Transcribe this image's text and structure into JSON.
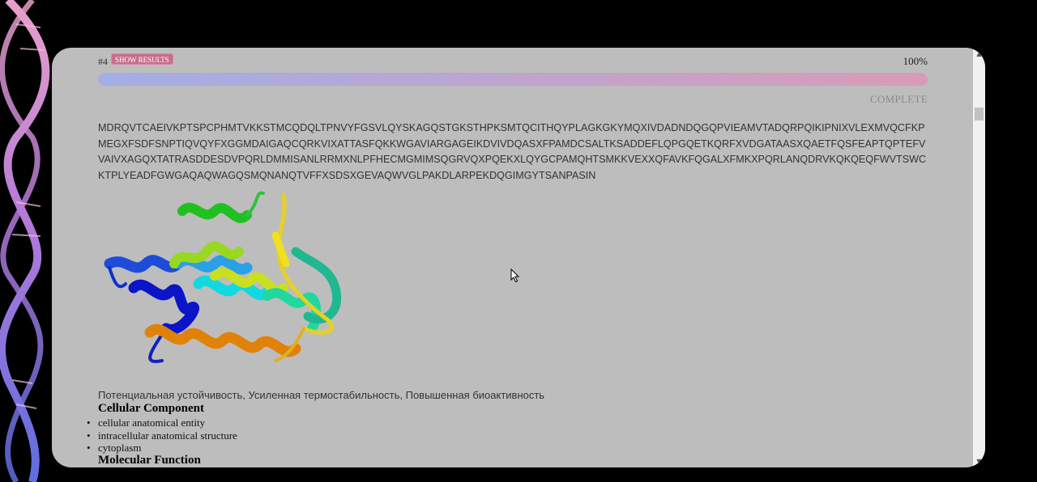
{
  "job": {
    "id_label": "#4",
    "show_results_label": "SHOW RESULTS",
    "progress_percent": 100,
    "progress_text": "100%",
    "status": "COMPLETE"
  },
  "sequence": "MDRQVTCAEIVKPTSPCPHMTVKKSTMCQDQLTPNVYFGSVLQYSKAGQSTGKSTHPKSMTQCITHQYPLAGKGKYMQXIVDADNDQGQPVIEAMVTADQRPQIKIPNIXVLEXMVQCFKPMEGXFSDFSNPTIQVQYFXGGMDAIGAQCQRKVIXATTASFQKKWGAVIARGAGEIKDVIVDQASXFPAMDCSALTKSADDEFLQPGQETKQRFXVDGATAASXQAETFQSFEAPTQPTEFVVAIVXAGQXTATRASDDESDVPQRLDMMISANLRRMXNLPFHECMGMIMSQGRVQXPQEKXLQYGCPAMQHTSMKKVEXXQFAVKFQGALXFMKXPQRLANQDRVKQKQEQFWVTSWCKTPLYEADFGWGAQAQWAGQSMQNANQTVFFXSDSXGEVAQWVGLPAKDLARPEKDQGIMGYTSANPASIN",
  "properties": "Потенциальная устойчивость, Усиленная термостабильность, Повышенная биоактивность",
  "go": {
    "cellular_component_title": "Cellular Component",
    "cellular_component": [
      "cellular anatomical entity",
      "intracellular anatomical structure",
      "cytoplasm"
    ],
    "molecular_function_title": "Molecular Function"
  },
  "icons": {
    "scroll_up": "scroll-up-arrow",
    "scroll_down": "scroll-down-arrow",
    "cursor": "mouse-pointer"
  },
  "colors": {
    "panel_bg": "#bdbdbd",
    "badge": "#c86e8c",
    "progress_start": "#a3aee6",
    "progress_end": "#d89bb6"
  }
}
